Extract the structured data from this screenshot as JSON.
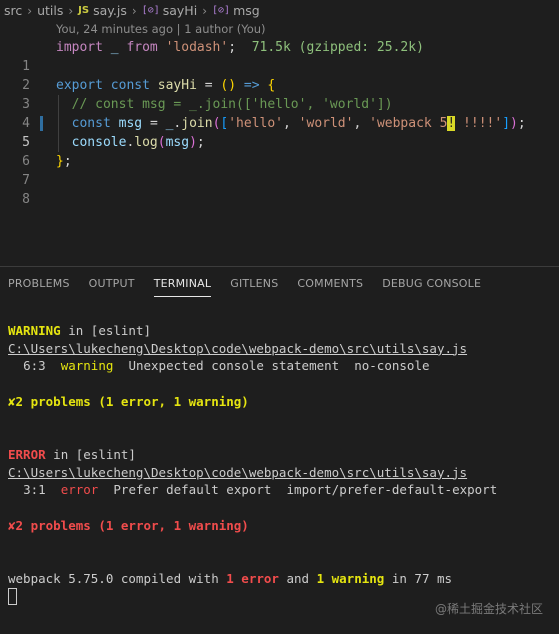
{
  "breadcrumb": {
    "items": [
      "src",
      "utils",
      "say.js",
      "sayHi",
      "msg"
    ],
    "file_icon": "JS",
    "symbol_icon": "[⊘]"
  },
  "editor": {
    "codelens": "You, 24 minutes ago | 1 author (You)",
    "active_line": 5,
    "lines": [
      {
        "n": "1",
        "text": "import _ from 'lodash';",
        "hint": "71.5k (gzipped: 25.2k)"
      },
      {
        "n": "2",
        "text": ""
      },
      {
        "n": "3",
        "text": "export const sayHi = () => {"
      },
      {
        "n": "4",
        "text": "  // const msg = _.join(['hello', 'world'])"
      },
      {
        "n": "5",
        "text": "  const msg = _.join(['hello', 'world', 'webpack 5! !!!!']);"
      },
      {
        "n": "6",
        "text": "  console.log(msg);"
      },
      {
        "n": "7",
        "text": "};"
      },
      {
        "n": "8",
        "text": ""
      }
    ]
  },
  "panel": {
    "tabs": [
      "PROBLEMS",
      "OUTPUT",
      "TERMINAL",
      "GITLENS",
      "COMMENTS",
      "DEBUG CONSOLE"
    ],
    "active_tab": "TERMINAL"
  },
  "terminal": {
    "block1": {
      "level": "WARNING",
      "source": " in [eslint]",
      "path": "C:\\Users\\lukecheng\\Desktop\\code\\webpack-demo\\src\\utils\\say.js",
      "pos": "6:3",
      "kind": "warning",
      "message": "Unexpected console statement",
      "rule": "no-console",
      "summary": "2 problems (1 error, 1 warning)"
    },
    "block2": {
      "level": "ERROR",
      "source": " in [eslint]",
      "path": "C:\\Users\\lukecheng\\Desktop\\code\\webpack-demo\\src\\utils\\say.js",
      "pos": "3:1",
      "kind": "error",
      "message": "Prefer default export",
      "rule": "import/prefer-default-export",
      "summary": "2 problems (1 error, 1 warning)"
    },
    "summary_icon": "✘",
    "compile": {
      "prefix": "webpack 5.75.0 compiled with ",
      "errors": "1 error",
      "mid": " and ",
      "warnings": "1 warning",
      "suffix": " in 77 ms"
    }
  },
  "watermark": "@稀土掘金技术社区",
  "colors": {
    "background": "#1e1e1e",
    "warning": "#e5e510",
    "error": "#f14c4c",
    "keyword": "#569cd6",
    "string": "#ce9178"
  }
}
